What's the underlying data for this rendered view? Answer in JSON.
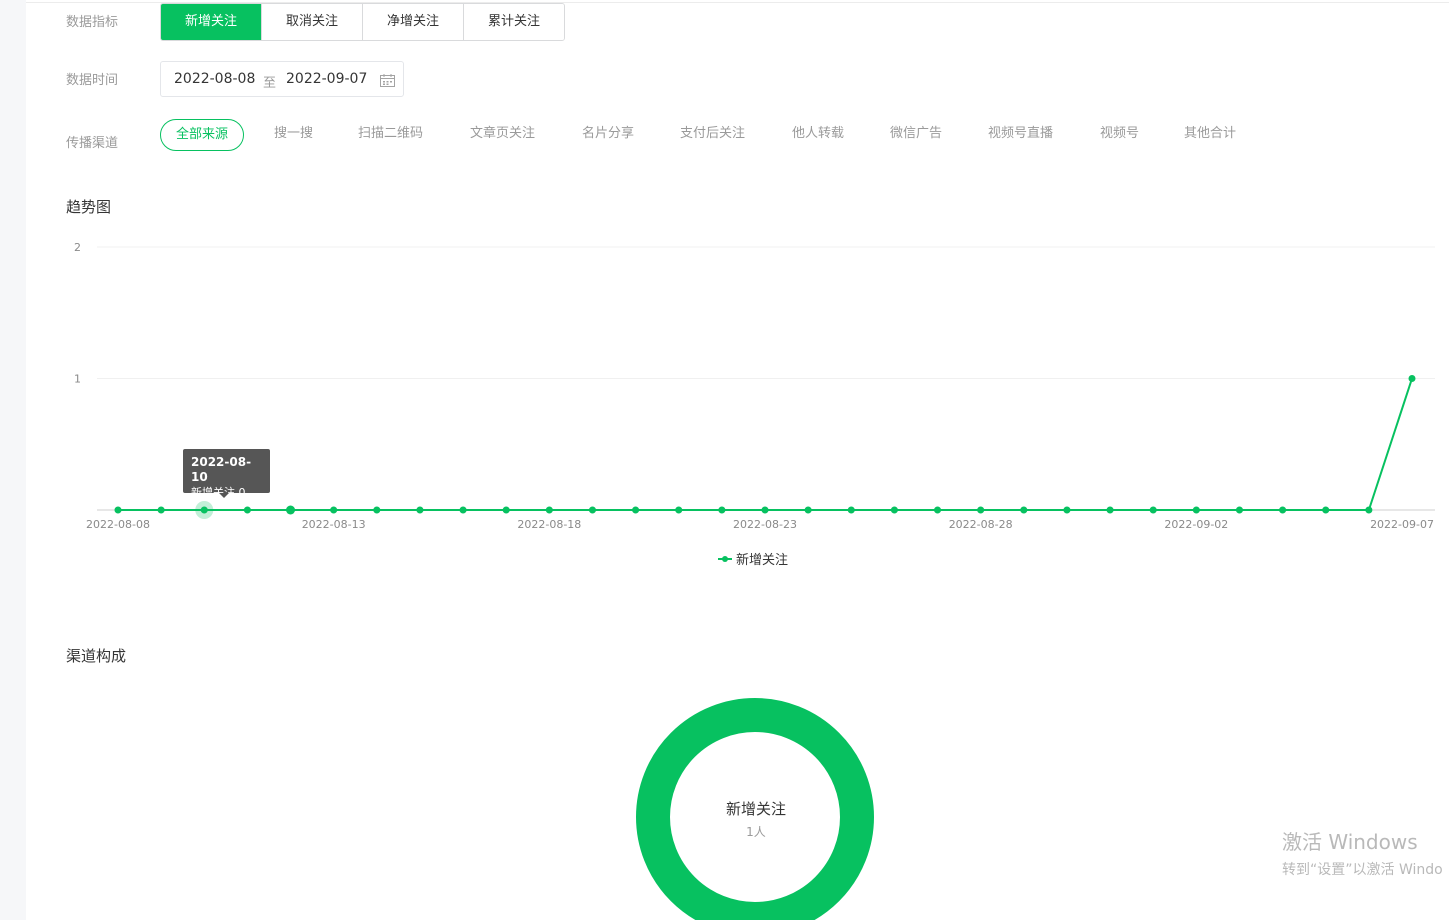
{
  "filters": {
    "metric_label": "数据指标",
    "metrics": [
      "新增关注",
      "取消关注",
      "净增关注",
      "累计关注"
    ],
    "active_metric": 0,
    "date_label": "数据时间",
    "date_start": "2022-08-08",
    "date_sep": "至",
    "date_end": "2022-09-07",
    "channel_label": "传播渠道",
    "channels": [
      "全部来源",
      "搜一搜",
      "扫描二维码",
      "文章页关注",
      "名片分享",
      "支付后关注",
      "他人转载",
      "微信广告",
      "视频号直播",
      "视频号",
      "其他合计"
    ],
    "active_channel": 0
  },
  "trend": {
    "title": "趋势图",
    "tooltip": {
      "date": "2022-08-10",
      "text": "新增关注 0"
    },
    "legend": "新增关注"
  },
  "composition": {
    "title": "渠道构成",
    "center_name": "新增关注",
    "center_value": "1人"
  },
  "watermark": {
    "line1": "激活 Windows",
    "line2": "转到“设置”以激活 Windo"
  },
  "colors": {
    "accent": "#07c160",
    "tooltip_bg": "#565656"
  },
  "chart_data": [
    {
      "type": "line",
      "x": [
        "2022-08-08",
        "2022-08-09",
        "2022-08-10",
        "2022-08-11",
        "2022-08-12",
        "2022-08-13",
        "2022-08-14",
        "2022-08-15",
        "2022-08-16",
        "2022-08-17",
        "2022-08-18",
        "2022-08-19",
        "2022-08-20",
        "2022-08-21",
        "2022-08-22",
        "2022-08-23",
        "2022-08-24",
        "2022-08-25",
        "2022-08-26",
        "2022-08-27",
        "2022-08-28",
        "2022-08-29",
        "2022-08-30",
        "2022-08-31",
        "2022-09-01",
        "2022-09-02",
        "2022-09-03",
        "2022-09-04",
        "2022-09-05",
        "2022-09-06",
        "2022-09-07"
      ],
      "x_tick_labels": [
        "2022-08-08",
        "2022-08-13",
        "2022-08-18",
        "2022-08-23",
        "2022-08-28",
        "2022-09-02",
        "2022-09-07"
      ],
      "series": [
        {
          "name": "新增关注",
          "values": [
            0,
            0,
            0,
            0,
            0,
            0,
            0,
            0,
            0,
            0,
            0,
            0,
            0,
            0,
            0,
            0,
            0,
            0,
            0,
            0,
            0,
            0,
            0,
            0,
            0,
            0,
            0,
            0,
            0,
            0,
            1
          ]
        }
      ],
      "ylim": [
        0,
        2
      ],
      "y_ticks": [
        "1",
        "2"
      ],
      "grid": true,
      "legend_position": "bottom-center",
      "highlighted_x": "2022-08-10"
    },
    {
      "type": "pie",
      "categories": [
        "新增关注"
      ],
      "values": [
        1
      ],
      "hole": true
    }
  ]
}
